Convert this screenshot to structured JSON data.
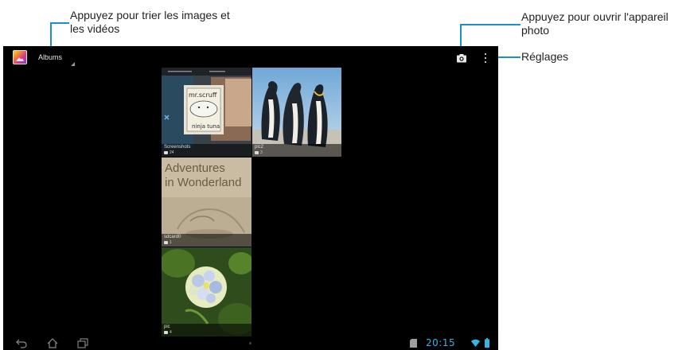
{
  "annotations": {
    "sort_line1": "Appuyez pour trier les images et",
    "sort_line2": "les vidéos",
    "camera_line1": "Appuyez pour ouvrir l'appareil",
    "camera_line2": "photo",
    "settings": "Réglages"
  },
  "action_bar": {
    "view_label": "Albums",
    "app_icon": "gallery-icon",
    "camera_icon": "camera-icon",
    "menu_icon": "overflow-menu-icon"
  },
  "albums": [
    {
      "name": "Screenshots",
      "count": "24"
    },
    {
      "name": "pic2",
      "count": "3"
    },
    {
      "name": "sdcard0",
      "count": "1"
    },
    {
      "name": "pic",
      "count": "4"
    }
  ],
  "artwork": {
    "sticker_line1": "mr.scruff",
    "sticker_line2": "ninja tuna",
    "book_line1": "Adventures",
    "book_line2": "in Wonderland"
  },
  "status_bar": {
    "time": "20:15",
    "nav_icons": [
      "back-icon",
      "home-icon",
      "recent-apps-icon"
    ],
    "status_icons": [
      "sd-card-icon",
      "wifi-icon",
      "battery-icon"
    ]
  },
  "colors": {
    "screen_bg": "#000000",
    "accent": "#33b5e5",
    "callout_line": "#1a8fc9"
  }
}
